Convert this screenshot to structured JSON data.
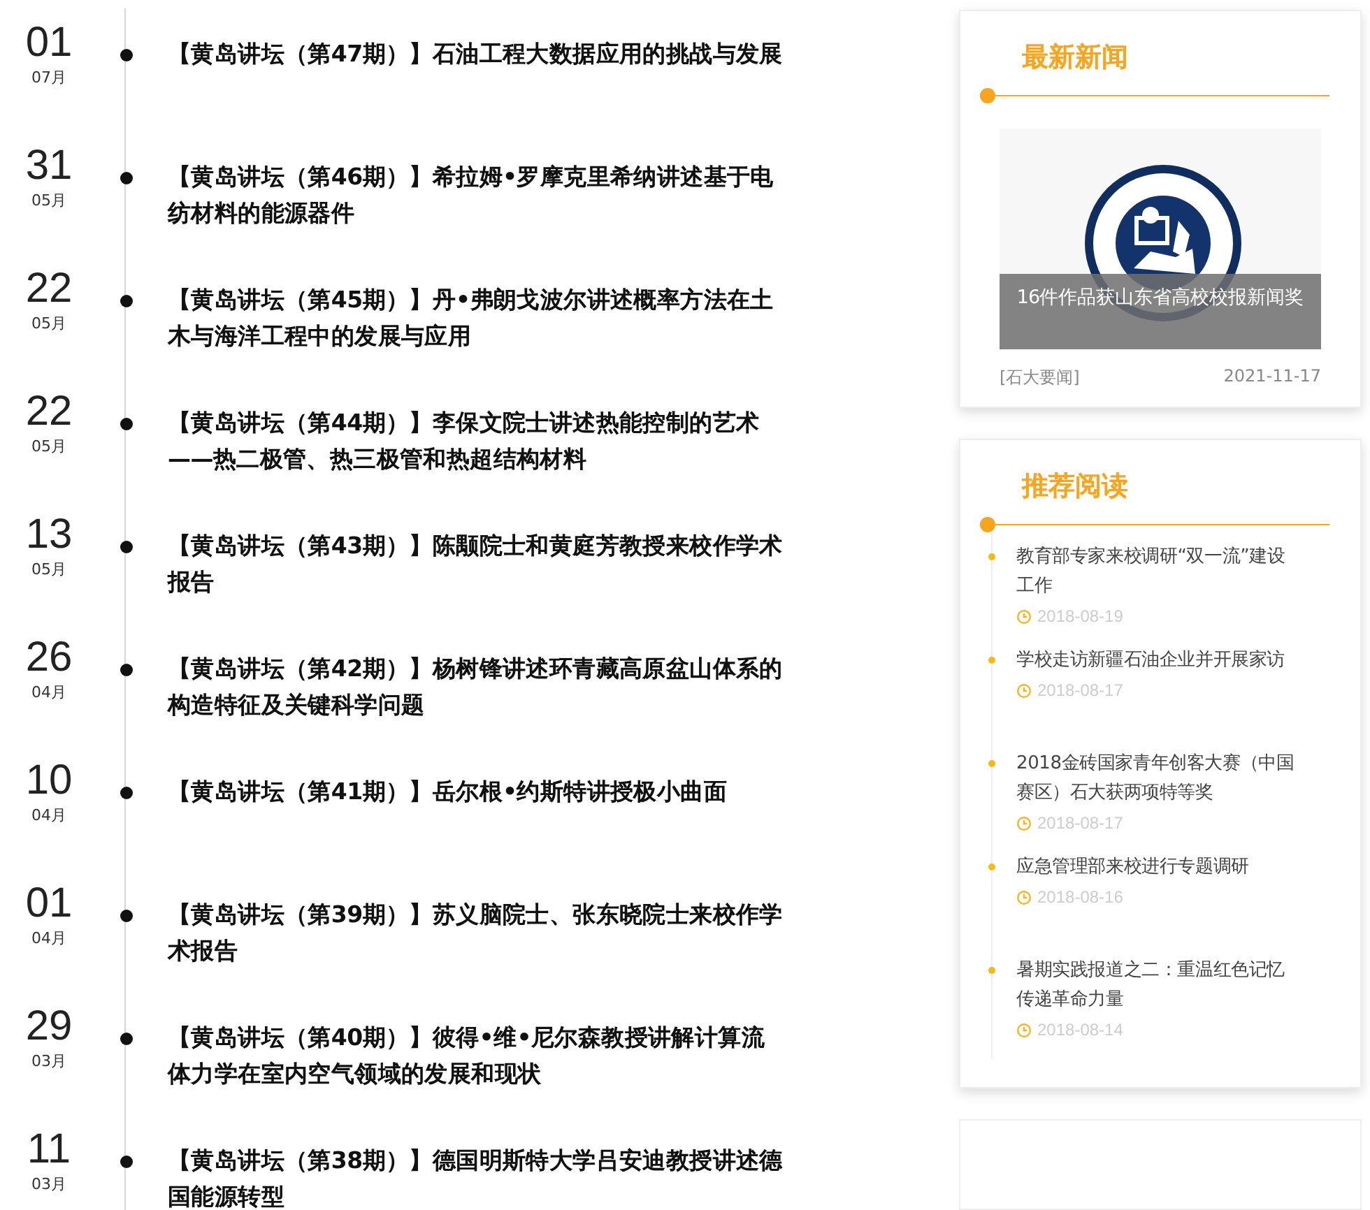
{
  "timeline": [
    {
      "day": "01",
      "month": "07月",
      "title": "【黄岛讲坛（第47期）】石油工程大数据应用的挑战与发展"
    },
    {
      "day": "31",
      "month": "05月",
      "title": "【黄岛讲坛（第46期）】希拉姆•罗摩克里希纳讲述基于电纺材料的能源器件"
    },
    {
      "day": "22",
      "month": "05月",
      "title": "【黄岛讲坛（第45期）】丹•弗朗戈波尔讲述概率方法在土木与海洋工程中的发展与应用"
    },
    {
      "day": "22",
      "month": "05月",
      "title": "【黄岛讲坛（第44期）】李保文院士讲述热能控制的艺术——热二极管、热三极管和热超结构材料"
    },
    {
      "day": "13",
      "month": "05月",
      "title": "【黄岛讲坛（第43期）】陈颙院士和黄庭芳教授来校作学术报告"
    },
    {
      "day": "26",
      "month": "04月",
      "title": "【黄岛讲坛（第42期）】杨树锋讲述环青藏高原盆山体系的构造特征及关键科学问题"
    },
    {
      "day": "10",
      "month": "04月",
      "title": "【黄岛讲坛（第41期）】岳尔根•约斯特讲授极小曲面"
    },
    {
      "day": "01",
      "month": "04月",
      "title": "【黄岛讲坛（第39期）】苏义脑院士、张东晓院士来校作学术报告"
    },
    {
      "day": "29",
      "month": "03月",
      "title": "【黄岛讲坛（第40期）】彼得•维•尼尔森教授讲解计算流体力学在室内空气领域的发展和现状"
    },
    {
      "day": "11",
      "month": "03月",
      "title": "【黄岛讲坛（第38期）】德国明斯特大学吕安迪教授讲述德国能源转型"
    }
  ],
  "latest_news": {
    "heading": "最新新闻",
    "feature": {
      "kind": "picture",
      "caption": "16件作品获山东省高校校报新闻奖",
      "category": "[石大要闻]",
      "date": "2021-11-17"
    }
  },
  "recommended": {
    "heading": "推荐阅读",
    "items": [
      {
        "title": "教育部专家来校调研“双一流”建设工作",
        "date": "2018-08-19"
      },
      {
        "title": "学校走访新疆石油企业并开展家访",
        "date": "2018-08-17"
      },
      {
        "title": "2018金砖国家青年创客大赛（中国赛区）石大获两项特等奖",
        "date": "2018-08-17"
      },
      {
        "title": "应急管理部来校进行专题调研",
        "date": "2018-08-16"
      },
      {
        "title": "暑期实践报道之二：重温红色记忆传递革命力量",
        "date": "2018-08-14"
      }
    ]
  }
}
